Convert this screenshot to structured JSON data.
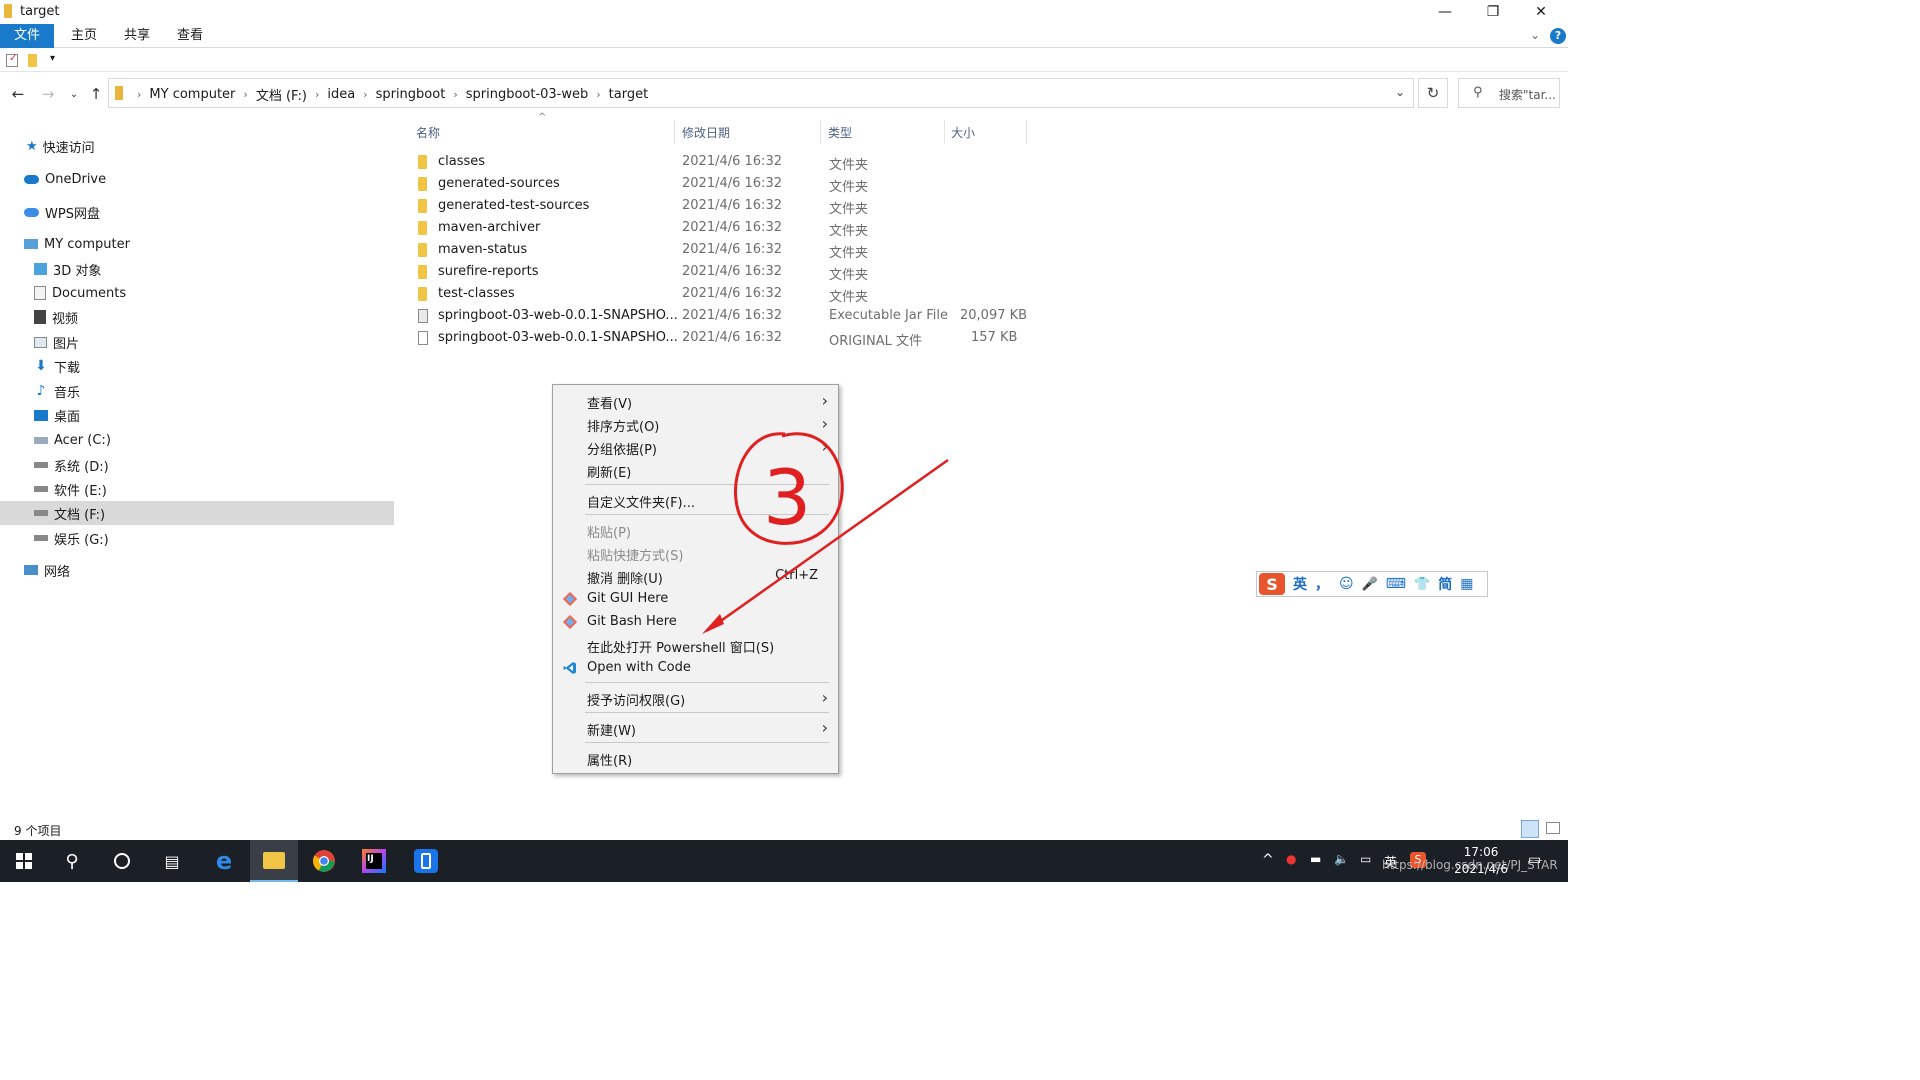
{
  "window": {
    "title": "target",
    "controls": {
      "minimize": "—",
      "restore": "❐",
      "close": "✕"
    }
  },
  "ribbon": {
    "tabs": [
      {
        "label": "文件",
        "active": true
      },
      {
        "label": "主页",
        "active": false
      },
      {
        "label": "共享",
        "active": false
      },
      {
        "label": "查看",
        "active": false
      }
    ],
    "help": "?"
  },
  "address": {
    "crumbs": [
      "MY computer",
      "文档 (F:)",
      "idea",
      "springboot",
      "springboot-03-web",
      "target"
    ],
    "search_placeholder": "搜索\"tar..."
  },
  "sidebar": {
    "items": [
      {
        "label": "快速访问",
        "icon": "star-icon"
      },
      {
        "label": "OneDrive",
        "icon": "cloud-icon"
      },
      {
        "label": "WPS网盘",
        "icon": "cloud-icon"
      },
      {
        "label": "MY computer",
        "icon": "computer-icon"
      },
      {
        "label": "3D 对象",
        "icon": "cube-icon"
      },
      {
        "label": "Documents",
        "icon": "document-icon"
      },
      {
        "label": "视频",
        "icon": "video-icon"
      },
      {
        "label": "图片",
        "icon": "picture-icon"
      },
      {
        "label": "下载",
        "icon": "download-icon"
      },
      {
        "label": "音乐",
        "icon": "music-icon"
      },
      {
        "label": "桌面",
        "icon": "desktop-icon"
      },
      {
        "label": "Acer (C:)",
        "icon": "drive-icon"
      },
      {
        "label": "系统 (D:)",
        "icon": "drive-icon"
      },
      {
        "label": "软件 (E:)",
        "icon": "drive-icon"
      },
      {
        "label": "文档 (F:)",
        "icon": "drive-icon",
        "selected": true
      },
      {
        "label": "娱乐 (G:)",
        "icon": "drive-icon"
      },
      {
        "label": "网络",
        "icon": "network-icon"
      }
    ]
  },
  "columns": {
    "name": "名称",
    "date": "修改日期",
    "type": "类型",
    "size": "大小"
  },
  "files": [
    {
      "name": "classes",
      "date": "2021/4/6 16:32",
      "type": "文件夹",
      "size": "",
      "kind": "folder"
    },
    {
      "name": "generated-sources",
      "date": "2021/4/6 16:32",
      "type": "文件夹",
      "size": "",
      "kind": "folder"
    },
    {
      "name": "generated-test-sources",
      "date": "2021/4/6 16:32",
      "type": "文件夹",
      "size": "",
      "kind": "folder"
    },
    {
      "name": "maven-archiver",
      "date": "2021/4/6 16:32",
      "type": "文件夹",
      "size": "",
      "kind": "folder"
    },
    {
      "name": "maven-status",
      "date": "2021/4/6 16:32",
      "type": "文件夹",
      "size": "",
      "kind": "folder"
    },
    {
      "name": "surefire-reports",
      "date": "2021/4/6 16:32",
      "type": "文件夹",
      "size": "",
      "kind": "folder"
    },
    {
      "name": "test-classes",
      "date": "2021/4/6 16:32",
      "type": "文件夹",
      "size": "",
      "kind": "folder"
    },
    {
      "name": "springboot-03-web-0.0.1-SNAPSHO...",
      "date": "2021/4/6 16:32",
      "type": "Executable Jar File",
      "size": "20,097 KB",
      "kind": "jar"
    },
    {
      "name": "springboot-03-web-0.0.1-SNAPSHO...",
      "date": "2021/4/6 16:32",
      "type": "ORIGINAL 文件",
      "size": "157 KB",
      "kind": "file"
    }
  ],
  "context_menu": {
    "items": [
      {
        "label": "查看(V)",
        "submenu": true
      },
      {
        "label": "排序方式(O)",
        "submenu": true
      },
      {
        "label": "分组依据(P)",
        "submenu": true
      },
      {
        "label": "刷新(E)"
      },
      {
        "label": "自定义文件夹(F)..."
      },
      {
        "label": "粘贴(P)",
        "disabled": true
      },
      {
        "label": "粘贴快捷方式(S)",
        "disabled": true
      },
      {
        "label": "撤消 删除(U)",
        "shortcut": "Ctrl+Z"
      },
      {
        "label": "Git GUI Here",
        "icon": "git-icon"
      },
      {
        "label": "Git Bash Here",
        "icon": "git-icon"
      },
      {
        "label": "在此处打开 Powershell 窗口(S)"
      },
      {
        "label": "Open with Code",
        "icon": "vscode-icon"
      },
      {
        "label": "授予访问权限(G)",
        "submenu": true
      },
      {
        "label": "新建(W)",
        "submenu": true
      },
      {
        "label": "属性(R)"
      }
    ]
  },
  "annotation": {
    "text": "3",
    "color": "#e02020"
  },
  "ime": {
    "items": [
      "英",
      "，",
      "☺",
      "🎤",
      "⌨",
      "👕",
      "简",
      "▦"
    ]
  },
  "status": {
    "count": "9 个项目"
  },
  "taskbar": {
    "clock_time": "17:06",
    "clock_date": "2021/4/6",
    "input_lang": "英",
    "watermark": "https://blog.csdn.net/PJ_STAR"
  },
  "colors": {
    "accent": "#1979ca",
    "taskbar": "#1b1f26",
    "selection": "#d9d9d9"
  }
}
